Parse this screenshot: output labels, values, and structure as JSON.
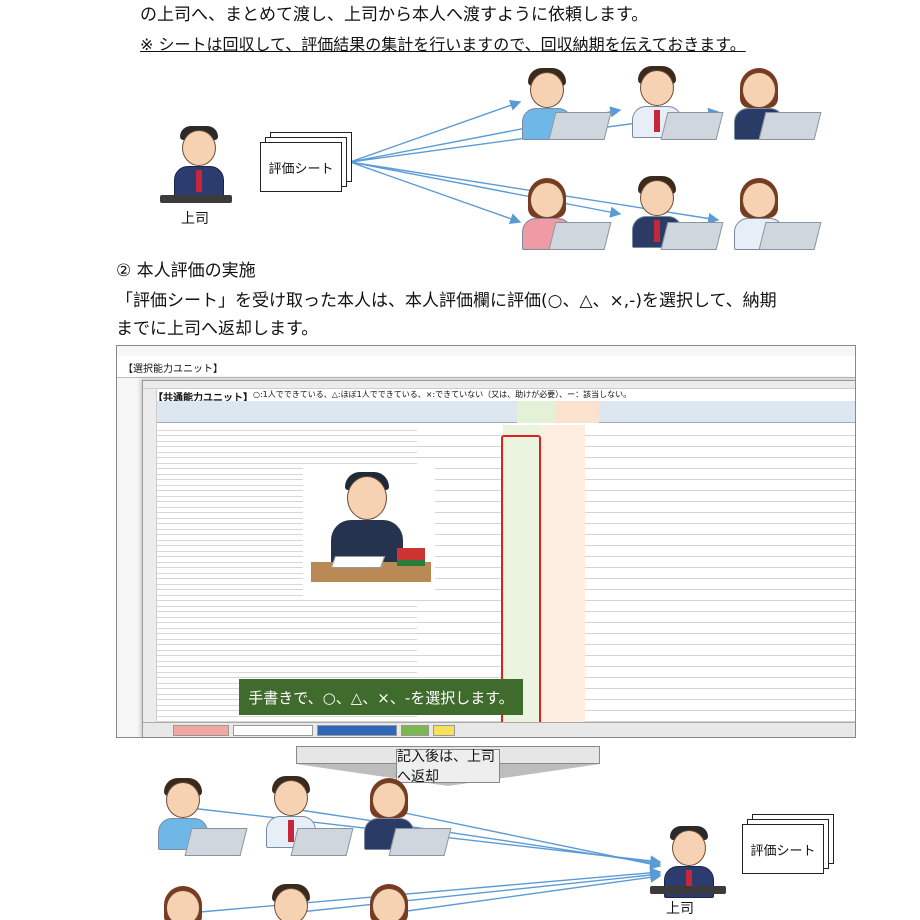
{
  "intro": {
    "line1": "の上司へ、まとめて渡し、上司から本人へ渡すように依頼します。",
    "note": "※ シートは回収して、評価結果の集計を行いますので、回収納期を伝えておきます。"
  },
  "top_diagram": {
    "sheet_label": "評価シート",
    "boss_label": "上司"
  },
  "section": {
    "heading": "② 本人評価の実施",
    "body1": "「評価シート」を受け取った本人は、本人評価欄に評価(○、△、×,-)を選択して、納期",
    "body2": "までに上司へ返却します。"
  },
  "spreadsheet": {
    "back_title": "【選択能力ユニット】",
    "front_title": "【共通能力ユニット】",
    "front_note": "○:1人でできている、△:ほぼ1人でできている、×:できていない（又は、助けが必要）、ー：該当しない。",
    "callout": "手書きで、○、△、×、-を選択します。"
  },
  "bottom_diagram": {
    "banner": "記入後は、上司へ返却",
    "sheet_label": "評価シート",
    "boss_label": "上司"
  }
}
